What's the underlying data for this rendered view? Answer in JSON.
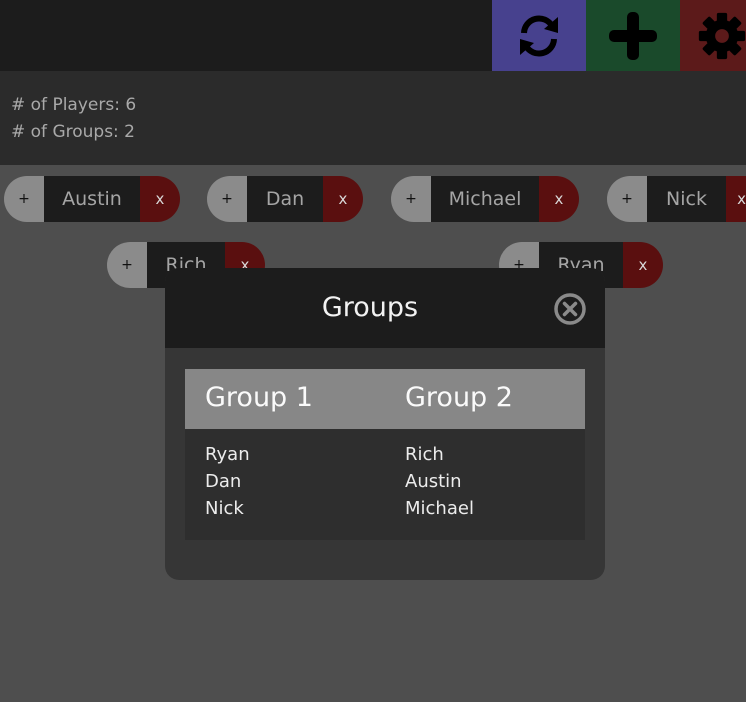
{
  "toolbar": {
    "refresh_color": "#47418e",
    "add_color": "#1a4a2b",
    "settings_color": "#5c1a1a"
  },
  "info": {
    "players_label": "# of Players: 6",
    "groups_label": "# of Groups: 2"
  },
  "players": [
    {
      "name": "Austin",
      "add": "+",
      "remove": "x"
    },
    {
      "name": "Dan",
      "add": "+",
      "remove": "x"
    },
    {
      "name": "Michael",
      "add": "+",
      "remove": "x"
    },
    {
      "name": "Nick",
      "add": "+",
      "remove": "x"
    },
    {
      "name": "Rich",
      "add": "+",
      "remove": "x"
    },
    {
      "name": "Ryan",
      "add": "+",
      "remove": "x"
    }
  ],
  "modal": {
    "title": "Groups",
    "groups": [
      {
        "title": "Group 1",
        "members": [
          "Ryan",
          "Dan",
          "Nick"
        ]
      },
      {
        "title": "Group 2",
        "members": [
          "Rich",
          "Austin",
          "Michael"
        ]
      }
    ]
  }
}
